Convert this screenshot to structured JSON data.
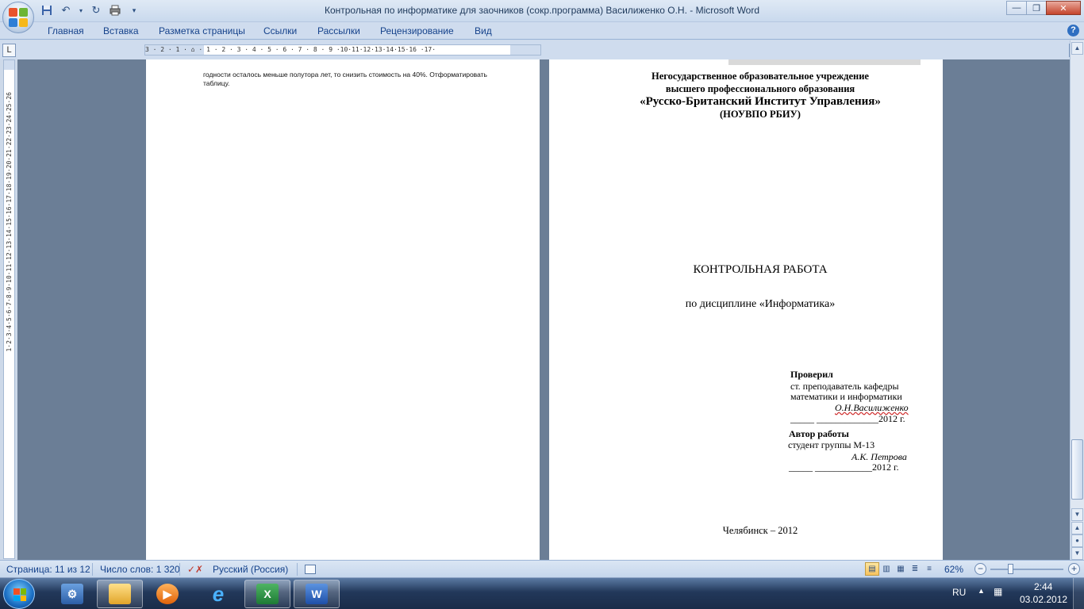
{
  "window": {
    "title": "Контрольная по информатике для заочников (сокр.программа) Василиженко О.Н. - Microsoft Word"
  },
  "ribbon": {
    "tabs": [
      "Главная",
      "Вставка",
      "Разметка страницы",
      "Ссылки",
      "Рассылки",
      "Рецензирование",
      "Вид"
    ]
  },
  "ruler": {
    "tab_selector": "L",
    "h_numbers": "3 · 2 · 1 · ⌂ · 1 · 2 · 3 · 4 · 5 · 6 · 7 · 8 · 9 ·10·11·12·13·14·15·16 ·17·",
    "v_numbers": "1·2·3·4·5·6·7·8·9·10·11·12·13·14·15·16·17·18·19·20·21·22·23·24·25·26"
  },
  "page1": {
    "text": "годности осталось меньше полутора лет, то снизить стоимость на 40%. Отформатировать таблицу."
  },
  "page2": {
    "org_line1": "Негосударственное образовательное учреждение",
    "org_line2": "высшего профессионального образования",
    "org_line3": "«Русско-Британский Институт Управления»",
    "org_line4": "(НОУВПО РБИУ)",
    "doc_title": "КОНТРОЛЬНАЯ РАБОТА",
    "discipline": "по дисциплине «Информатика»",
    "checked_label": "Проверил",
    "checked_pos1": "ст. преподаватель кафедры",
    "checked_pos2": "математики и информатики",
    "checked_name": "О.Н.Василиженко",
    "checked_date": "_____ _____________2012 г.",
    "author_label": "Автор работы",
    "author_group": "студент группы М-13",
    "author_name": "А.К. Петрова",
    "author_date": "_____ ____________2012 г.",
    "city_year": "Челябинск – 2012"
  },
  "status": {
    "page": "Страница: 11 из 12",
    "words": "Число слов: 1 320",
    "language": "Русский (Россия)",
    "zoom": "62%",
    "zoom_level": 0.62
  },
  "taskbar": {
    "lang": "RU",
    "time": "2:44",
    "date": "03.02.2012",
    "apps": [
      "windows-explorer",
      "media-player",
      "internet-explorer",
      "excel",
      "word"
    ]
  },
  "colors": {
    "ribbon_text": "#15428b",
    "doc_background": "#6b7e96",
    "taskbar": "#22385a"
  }
}
